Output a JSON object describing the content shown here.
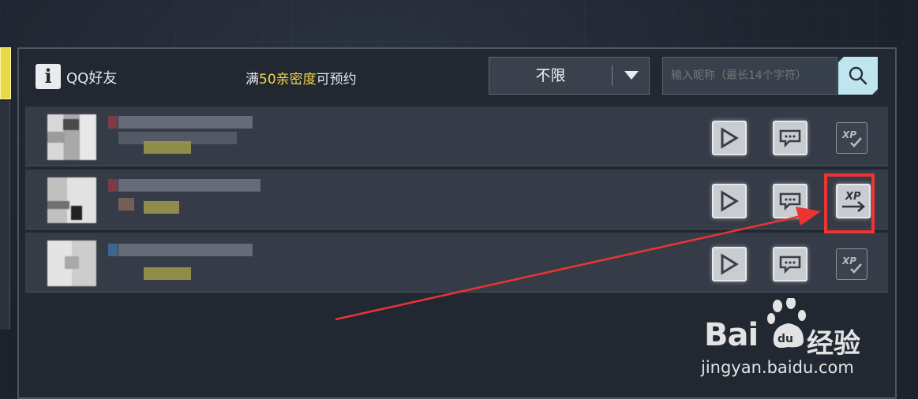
{
  "header": {
    "title": "QQ好友",
    "info_icon_glyph": "i",
    "hint_prefix": "满",
    "hint_highlight": "50亲密度",
    "hint_suffix": "可预约"
  },
  "filter": {
    "selected": "不限"
  },
  "search": {
    "placeholder": "输入昵称（最长14个字符）"
  },
  "friends": [
    {
      "xp_state": "available"
    },
    {
      "xp_state": "transfer"
    },
    {
      "xp_state": "available"
    }
  ],
  "watermark": {
    "brand_left": "Bai",
    "brand_right": "经验",
    "paw_text": "du",
    "url": "jingyan.baidu.com"
  },
  "colors": {
    "highlight": "#f2d64b",
    "annotation_red": "#ee3333",
    "search_bg": "#bfe6ee"
  }
}
